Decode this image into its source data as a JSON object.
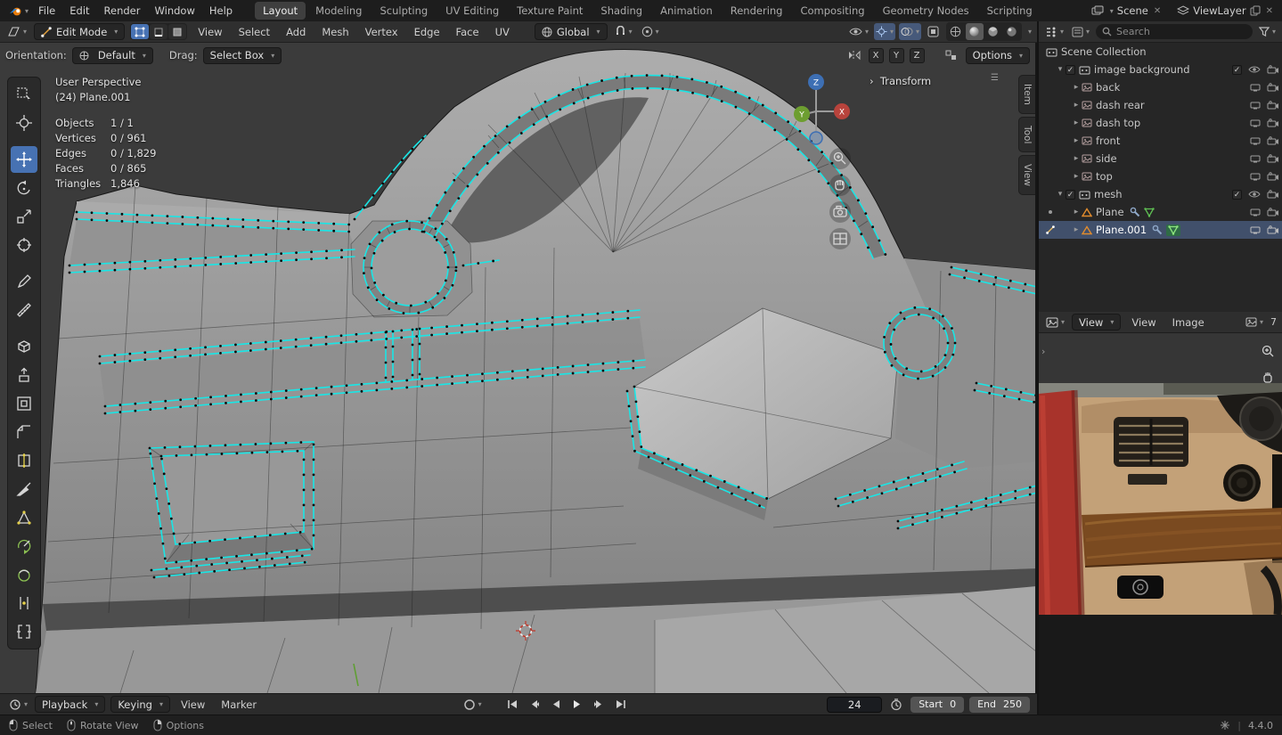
{
  "topbar": {
    "menus": [
      "File",
      "Edit",
      "Render",
      "Window",
      "Help"
    ],
    "workspaces": [
      "Layout",
      "Modeling",
      "Sculpting",
      "UV Editing",
      "Texture Paint",
      "Shading",
      "Animation",
      "Rendering",
      "Compositing",
      "Geometry Nodes",
      "Scripting"
    ],
    "scene_label": "Scene",
    "viewlayer_label": "ViewLayer"
  },
  "viewport_header": {
    "mode": "Edit Mode",
    "menus": [
      "View",
      "Select",
      "Add",
      "Mesh",
      "Vertex",
      "Edge",
      "Face",
      "UV"
    ],
    "orientation": "Global"
  },
  "tool_settings": {
    "orientation_label": "Orientation:",
    "orientation_value": "Default",
    "drag_label": "Drag:",
    "drag_value": "Select Box",
    "axes": [
      "X",
      "Y",
      "Z"
    ],
    "options": "Options"
  },
  "viewport": {
    "view_name": "User Perspective",
    "object_name": "(24) Plane.001",
    "stats": {
      "objects_label": "Objects",
      "objects": "1 / 1",
      "vertices_label": "Vertices",
      "vertices": "0 / 961",
      "edges_label": "Edges",
      "edges": "0 / 1,829",
      "faces_label": "Faces",
      "faces": "0 / 865",
      "triangles_label": "Triangles",
      "triangles": "1,846"
    },
    "transform_panel": "Transform",
    "sidebar_tabs": [
      "Item",
      "Tool",
      "View"
    ],
    "gizmo": {
      "x": "X",
      "y": "Y",
      "z": "Z"
    }
  },
  "outliner": {
    "search_placeholder": "Search",
    "scene_collection": "Scene Collection",
    "collection1": "image background",
    "images": [
      "back",
      "dash rear",
      "dash top",
      "front",
      "side",
      "top"
    ],
    "collection2": "mesh",
    "objects": [
      "Plane",
      "Plane.001"
    ]
  },
  "image_editor": {
    "mode": "View",
    "menus": [
      "View",
      "Image"
    ],
    "datablock": "7"
  },
  "timeline": {
    "playback": "Playback",
    "keying": "Keying",
    "view": "View",
    "marker": "Marker",
    "current_frame": "24",
    "start_label": "Start",
    "start_value": "0",
    "end_label": "End",
    "end_value": "250"
  },
  "statusbar": {
    "select": "Select",
    "rotate_view": "Rotate View",
    "options": "Options",
    "version": "4.4.0"
  }
}
